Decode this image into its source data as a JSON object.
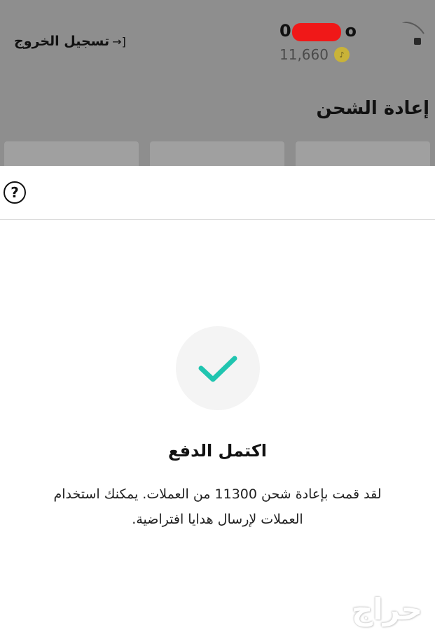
{
  "header": {
    "logout_label": "تسجيل الخروج",
    "logout_icon": "logout-arrow-icon",
    "username_start": "0",
    "username_end": "o",
    "coin_balance": "11,660",
    "coin_icon": "tiktok-coin-icon"
  },
  "page": {
    "recharge_title": "إعادة الشحن"
  },
  "sheet": {
    "help_icon": "help-icon",
    "status_title": "اكتمل الدفع",
    "status_message": "لقد قمت بإعادة شحن 11300 من العملات. يمكنك استخدام العملات لإرسال هدايا افتراضية.",
    "check_color": "#20c5b0"
  },
  "watermark": {
    "text": "حراج"
  },
  "colors": {
    "dim_overlay": "#8e8e8e",
    "redaction": "#f01818",
    "accent": "#20c5b0"
  }
}
